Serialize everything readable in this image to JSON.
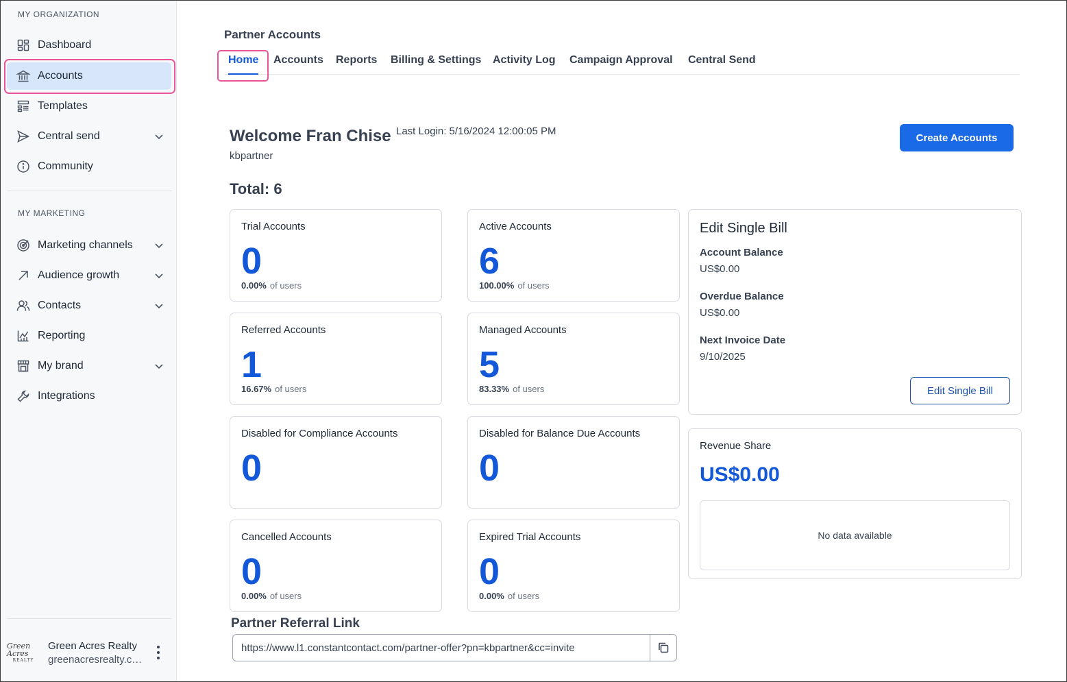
{
  "sidebar": {
    "org_section": "MY ORGANIZATION",
    "org_items": [
      {
        "label": "Dashboard",
        "icon": "dashboard-icon"
      },
      {
        "label": "Accounts",
        "icon": "bank-icon",
        "active": true
      },
      {
        "label": "Templates",
        "icon": "templates-icon"
      },
      {
        "label": "Central send",
        "icon": "send-icon",
        "expandable": true
      },
      {
        "label": "Community",
        "icon": "info-icon"
      }
    ],
    "marketing_section": "MY MARKETING",
    "marketing_items": [
      {
        "label": "Marketing channels",
        "icon": "target-icon",
        "expandable": true
      },
      {
        "label": "Audience growth",
        "icon": "arrow-up-right-icon",
        "expandable": true
      },
      {
        "label": "Contacts",
        "icon": "people-icon",
        "expandable": true
      },
      {
        "label": "Reporting",
        "icon": "chart-icon"
      },
      {
        "label": "My brand",
        "icon": "store-icon",
        "expandable": true
      },
      {
        "label": "Integrations",
        "icon": "wrench-icon"
      }
    ],
    "account": {
      "logo_text": "Green Acres",
      "logo_sub": "REALTY",
      "name": "Green Acres Realty",
      "email": "greenacresrealty.com"
    }
  },
  "header": {
    "title": "Partner Accounts",
    "tabs": [
      {
        "label": "Home",
        "active": true
      },
      {
        "label": "Accounts"
      },
      {
        "label": "Reports"
      },
      {
        "label": "Billing & Settings"
      },
      {
        "label": "Activity Log"
      },
      {
        "label": "Campaign Approval"
      },
      {
        "label": "Central Send"
      }
    ]
  },
  "welcome": {
    "greeting": "Welcome Fran Chise",
    "last_login": "Last Login: 5/16/2024 12:00:05 PM",
    "username": "kbpartner",
    "create_button": "Create Accounts",
    "total": "Total: 6"
  },
  "cards": [
    {
      "title": "Trial Accounts",
      "value": "0",
      "percent": "0.00%",
      "suffix": "of users"
    },
    {
      "title": "Active Accounts",
      "value": "6",
      "percent": "100.00%",
      "suffix": "of users"
    },
    {
      "title": "Referred Accounts",
      "value": "1",
      "percent": "16.67%",
      "suffix": "of users"
    },
    {
      "title": "Managed Accounts",
      "value": "5",
      "percent": "83.33%",
      "suffix": "of users"
    },
    {
      "title": "Disabled for Compliance Accounts",
      "value": "0",
      "percent": "",
      "suffix": ""
    },
    {
      "title": "Disabled for Balance Due Accounts",
      "value": "0",
      "percent": "",
      "suffix": ""
    },
    {
      "title": "Cancelled Accounts",
      "value": "0",
      "percent": "0.00%",
      "suffix": "of users"
    },
    {
      "title": "Expired Trial Accounts",
      "value": "0",
      "percent": "0.00%",
      "suffix": "of users"
    }
  ],
  "billing": {
    "title": "Edit Single Bill",
    "account_balance_label": "Account Balance",
    "account_balance_value": "US$0.00",
    "overdue_label": "Overdue Balance",
    "overdue_value": "US$0.00",
    "next_invoice_label": "Next Invoice Date",
    "next_invoice_value": "9/10/2025",
    "edit_button": "Edit Single Bill"
  },
  "revenue": {
    "title": "Revenue Share",
    "value": "US$0.00",
    "empty": "No data available"
  },
  "referral": {
    "title": "Partner Referral Link",
    "url": "https://www.l1.constantcontact.com/partner-offer?pn=kbpartner&cc=invite"
  },
  "colors": {
    "accent": "#1358d8",
    "button": "#1a6ae8",
    "highlight": "#e8559a",
    "active_nav": "#d7e6fb"
  }
}
